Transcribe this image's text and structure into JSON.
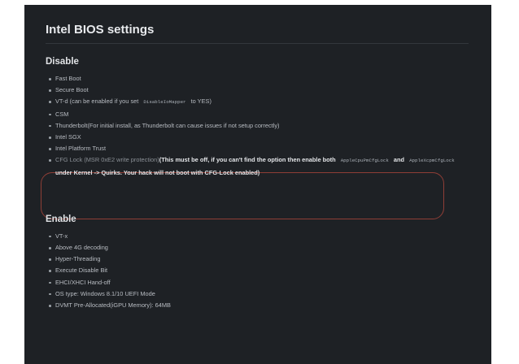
{
  "page": {
    "title": "Intel BIOS settings"
  },
  "disable": {
    "heading": "Disable",
    "items": [
      {
        "text": "Fast Boot"
      },
      {
        "text": "Secure Boot"
      },
      {
        "pre": "VT-d (can be enabled if you set ",
        "code": "DisableIoMapper",
        "post": " to YES)"
      },
      {
        "text": "CSM"
      },
      {
        "text": "Thunderbolt(For initial install, as Thunderbolt can cause issues if not setup correctly)"
      },
      {
        "text": "Intel SGX"
      },
      {
        "text": "Intel Platform Trust"
      }
    ],
    "cfg_lock": {
      "normal": "CFG Lock (MSR 0xE2 write protection)",
      "bold_1": "(This must be off, if you can't find the option then enable both ",
      "code_1": "AppleCpuPmCfgLock",
      "bold_2": " and ",
      "code_2": "AppleXcpmCfgLock",
      "bold_3": " under Kernel -> Quirks. Your hack will not boot with CFG-Lock enabled)"
    }
  },
  "enable": {
    "heading": "Enable",
    "items": [
      "VT-x",
      "Above 4G decoding",
      "Hyper-Threading",
      "Execute Disable Bit",
      "EHCI/XHCI Hand-off",
      "OS type: Windows 8.1/10 UEFI Mode",
      "DVMT Pre-Allocated(iGPU Memory): 64MB"
    ]
  },
  "colors": {
    "background": "#1e2125",
    "annotation_outline": "#8f3e36"
  }
}
